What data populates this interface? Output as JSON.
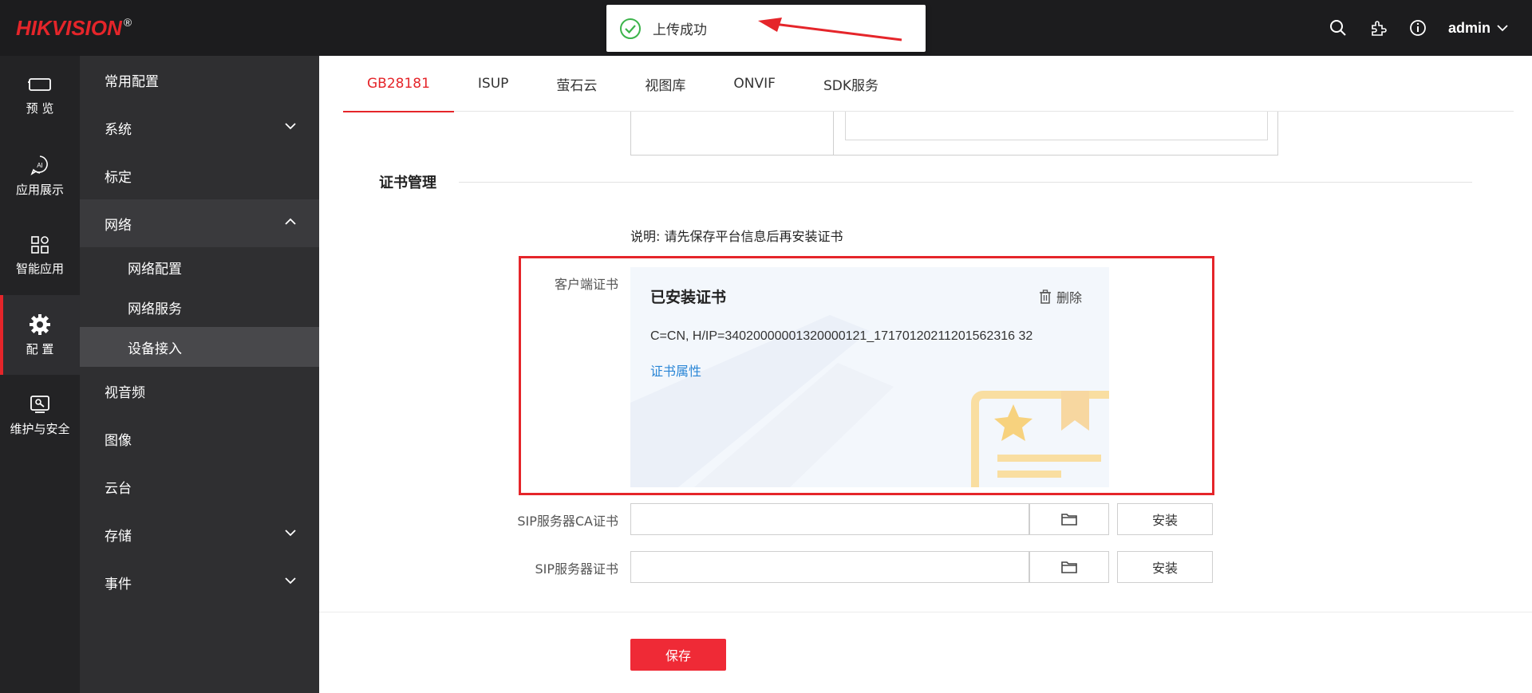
{
  "app": {
    "logo": "HIKVISION",
    "logo_mark": "®",
    "user": "admin"
  },
  "toast": {
    "message": "上传成功"
  },
  "rail": {
    "items": [
      {
        "label": "预 览",
        "icon": "monitor-icon"
      },
      {
        "label": "应用展示",
        "icon": "ai-icon"
      },
      {
        "label": "智能应用",
        "icon": "apps-icon"
      },
      {
        "label": "配 置",
        "icon": "gear-icon"
      },
      {
        "label": "维护与安全",
        "icon": "maintenance-icon"
      }
    ]
  },
  "submenu": {
    "items": [
      {
        "label": "常用配置"
      },
      {
        "label": "系统"
      },
      {
        "label": "标定"
      },
      {
        "label": "网络"
      },
      {
        "label": "网络配置"
      },
      {
        "label": "网络服务"
      },
      {
        "label": "设备接入"
      },
      {
        "label": "视音频"
      },
      {
        "label": "图像"
      },
      {
        "label": "云台"
      },
      {
        "label": "存储"
      },
      {
        "label": "事件"
      }
    ]
  },
  "tabs": [
    "GB28181",
    "ISUP",
    "萤石云",
    "视图库",
    "ONVIF",
    "SDK服务"
  ],
  "cert_section": {
    "title": "证书管理",
    "note": "说明: 请先保存平台信息后再安装证书",
    "client_label": "客户端证书",
    "installed_title": "已安装证书",
    "delete_label": "删除",
    "cert_info": "C=CN, H/IP=34020000001320000121_17170120211201562316 32",
    "cert_link": "证书属性",
    "sip_ca_label": "SIP服务器CA证书",
    "sip_label": "SIP服务器证书",
    "install_label": "安装"
  },
  "footer": {
    "save_label": "保存"
  },
  "colors": {
    "accent": "#e5252a",
    "link": "#2a86d6",
    "success": "#3cb44b",
    "topbar": "#1c1c1e",
    "sidebar": "#2f2f31"
  }
}
